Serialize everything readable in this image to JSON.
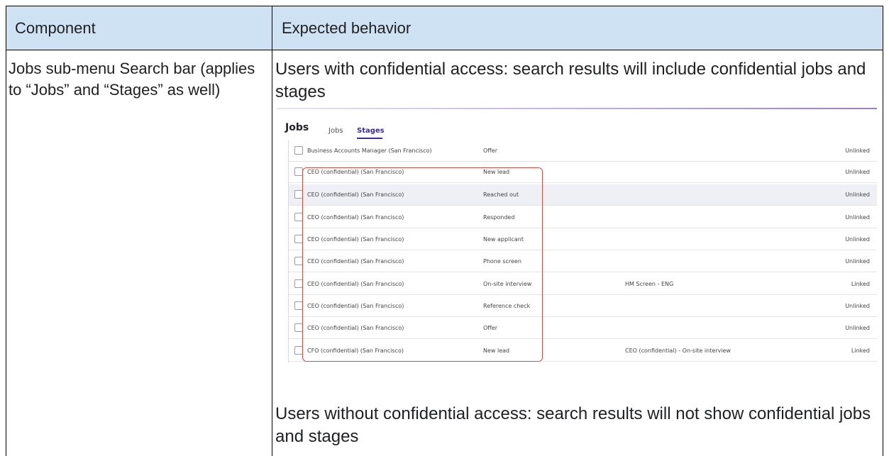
{
  "table": {
    "header": {
      "component": "Component",
      "expected": "Expected behavior"
    },
    "row": {
      "component": "Jobs sub-menu Search bar (applies to “Jobs” and “Stages” as well)",
      "with_access": "Users with confidential access: search results will include confidential jobs and stages",
      "without_access": "Users without confidential access: search results will not show confidential jobs and stages"
    }
  },
  "screenshot": {
    "title": "Jobs",
    "tabs": [
      "Jobs",
      "Stages"
    ],
    "active_tab": "Stages",
    "rows": [
      {
        "job": "Business Accounts Manager (San Francisco)",
        "stage": "Offer",
        "linked_stage": "",
        "status": "Unlinked"
      },
      {
        "job": "CEO (confidential) (San Francisco)",
        "stage": "New lead",
        "linked_stage": "",
        "status": "Unlinked"
      },
      {
        "job": "CEO (confidential) (San Francisco)",
        "stage": "Reached out",
        "linked_stage": "",
        "status": "Unlinked"
      },
      {
        "job": "CEO (confidential) (San Francisco)",
        "stage": "Responded",
        "linked_stage": "",
        "status": "Unlinked"
      },
      {
        "job": "CEO (confidential) (San Francisco)",
        "stage": "New applicant",
        "linked_stage": "",
        "status": "Unlinked"
      },
      {
        "job": "CEO (confidential) (San Francisco)",
        "stage": "Phone screen",
        "linked_stage": "",
        "status": "Unlinked"
      },
      {
        "job": "CEO (confidential) (San Francisco)",
        "stage": "On-site interview",
        "linked_stage": "HM Screen - ENG",
        "status": "Linked"
      },
      {
        "job": "CEO (confidential) (San Francisco)",
        "stage": "Reference check",
        "linked_stage": "",
        "status": "Unlinked"
      },
      {
        "job": "CEO (confidential) (San Francisco)",
        "stage": "Offer",
        "linked_stage": "",
        "status": "Unlinked"
      },
      {
        "job": "CFO (confidential) (San Francisco)",
        "stage": "New lead",
        "linked_stage": "CEO (confidential) - On-site interview",
        "status": "Linked"
      }
    ],
    "highlight_color": "#e04a3b",
    "accent_color": "#3d2e9a"
  }
}
